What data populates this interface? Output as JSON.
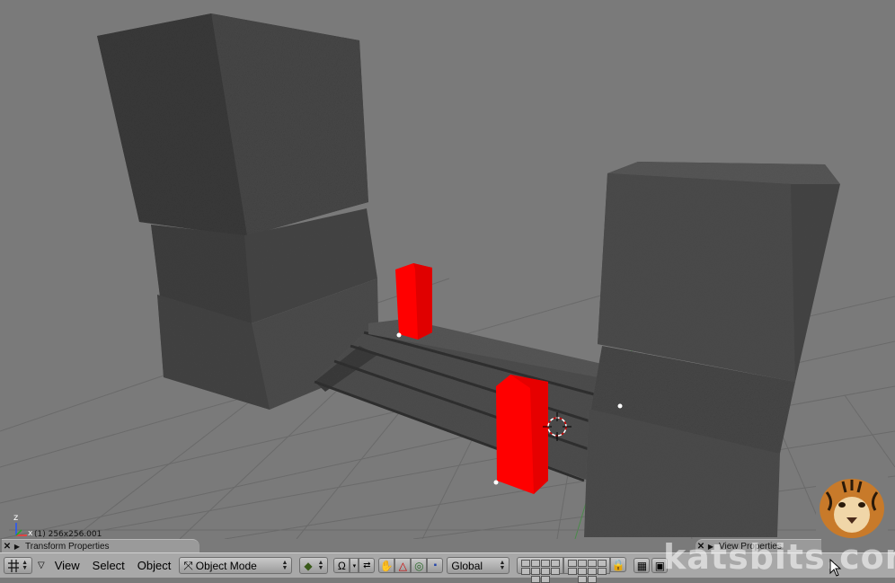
{
  "viewport": {
    "background": "#7a7a7a",
    "stone_color": "#474747",
    "selected_color": "#ff0000",
    "coord_readout": "(1) 256x256.001",
    "axis_z": "z",
    "axis_x": "x"
  },
  "panels": {
    "left_title": "Transform Properties",
    "right_title": "View Properties"
  },
  "header": {
    "menus": [
      "View",
      "Select",
      "Object"
    ],
    "mode": "Object Mode",
    "orientation": "Global"
  },
  "watermark": "katsbits.com",
  "icons": {
    "window_type": "grid-icon",
    "draw_type": "solid-cube-icon",
    "pivot": "pivot-icon",
    "manipulator": "hand-icon",
    "translate": "triangle-icon",
    "rotate": "ring-icon",
    "scale": "square-icon",
    "lock": "lock-icon",
    "render": "render-icon"
  }
}
